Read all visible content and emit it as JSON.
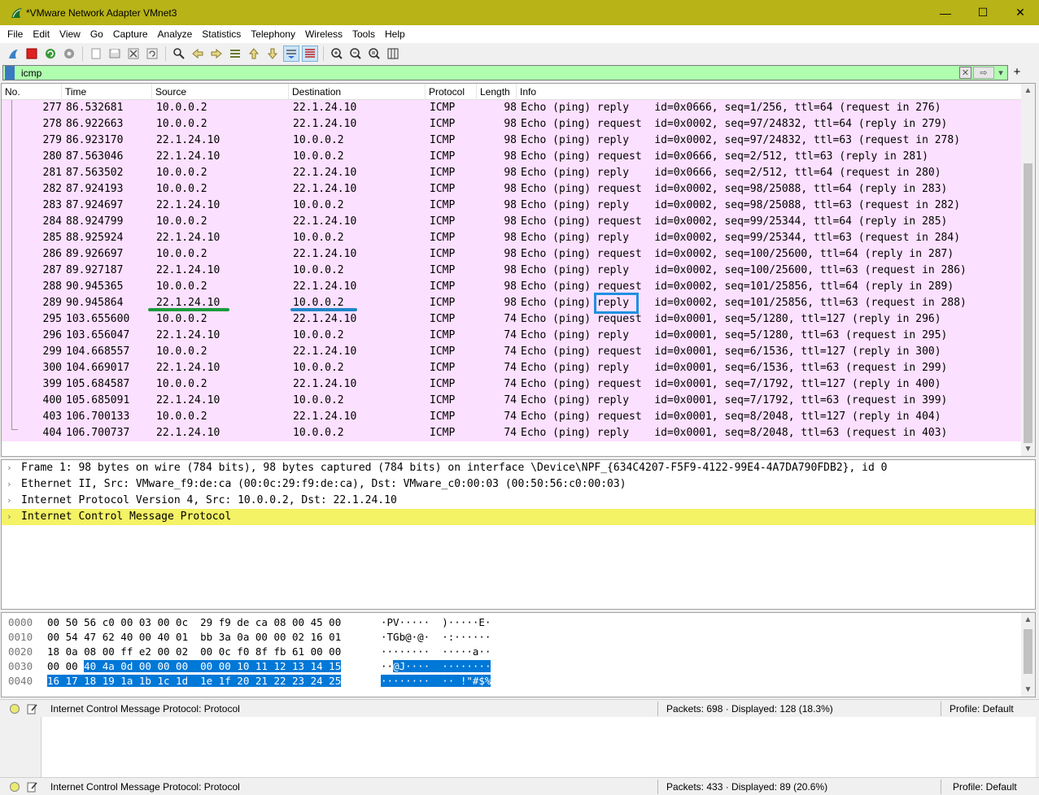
{
  "window": {
    "title": "*VMware Network Adapter VMnet3",
    "minimize": "—",
    "maximize": "☐",
    "close": "✕"
  },
  "menu": [
    "File",
    "Edit",
    "View",
    "Go",
    "Capture",
    "Analyze",
    "Statistics",
    "Telephony",
    "Wireless",
    "Tools",
    "Help"
  ],
  "filter": {
    "value": "icmp",
    "plus": "+"
  },
  "columns": [
    "No.",
    "Time",
    "Source",
    "Destination",
    "Protocol",
    "Length",
    "Info"
  ],
  "packets": [
    {
      "no": "277",
      "time": "86.532681",
      "src": "10.0.0.2",
      "dst": "22.1.24.10",
      "proto": "ICMP",
      "len": "98",
      "info": "Echo (ping) reply    id=0x0666, seq=1/256, ttl=64 (request in 276)"
    },
    {
      "no": "278",
      "time": "86.922663",
      "src": "10.0.0.2",
      "dst": "22.1.24.10",
      "proto": "ICMP",
      "len": "98",
      "info": "Echo (ping) request  id=0x0002, seq=97/24832, ttl=64 (reply in 279)"
    },
    {
      "no": "279",
      "time": "86.923170",
      "src": "22.1.24.10",
      "dst": "10.0.0.2",
      "proto": "ICMP",
      "len": "98",
      "info": "Echo (ping) reply    id=0x0002, seq=97/24832, ttl=63 (request in 278)"
    },
    {
      "no": "280",
      "time": "87.563046",
      "src": "22.1.24.10",
      "dst": "10.0.0.2",
      "proto": "ICMP",
      "len": "98",
      "info": "Echo (ping) request  id=0x0666, seq=2/512, ttl=63 (reply in 281)"
    },
    {
      "no": "281",
      "time": "87.563502",
      "src": "10.0.0.2",
      "dst": "22.1.24.10",
      "proto": "ICMP",
      "len": "98",
      "info": "Echo (ping) reply    id=0x0666, seq=2/512, ttl=64 (request in 280)"
    },
    {
      "no": "282",
      "time": "87.924193",
      "src": "10.0.0.2",
      "dst": "22.1.24.10",
      "proto": "ICMP",
      "len": "98",
      "info": "Echo (ping) request  id=0x0002, seq=98/25088, ttl=64 (reply in 283)"
    },
    {
      "no": "283",
      "time": "87.924697",
      "src": "22.1.24.10",
      "dst": "10.0.0.2",
      "proto": "ICMP",
      "len": "98",
      "info": "Echo (ping) reply    id=0x0002, seq=98/25088, ttl=63 (request in 282)"
    },
    {
      "no": "284",
      "time": "88.924799",
      "src": "10.0.0.2",
      "dst": "22.1.24.10",
      "proto": "ICMP",
      "len": "98",
      "info": "Echo (ping) request  id=0x0002, seq=99/25344, ttl=64 (reply in 285)"
    },
    {
      "no": "285",
      "time": "88.925924",
      "src": "22.1.24.10",
      "dst": "10.0.0.2",
      "proto": "ICMP",
      "len": "98",
      "info": "Echo (ping) reply    id=0x0002, seq=99/25344, ttl=63 (request in 284)"
    },
    {
      "no": "286",
      "time": "89.926697",
      "src": "10.0.0.2",
      "dst": "22.1.24.10",
      "proto": "ICMP",
      "len": "98",
      "info": "Echo (ping) request  id=0x0002, seq=100/25600, ttl=64 (reply in 287)"
    },
    {
      "no": "287",
      "time": "89.927187",
      "src": "22.1.24.10",
      "dst": "10.0.0.2",
      "proto": "ICMP",
      "len": "98",
      "info": "Echo (ping) reply    id=0x0002, seq=100/25600, ttl=63 (request in 286)"
    },
    {
      "no": "288",
      "time": "90.945365",
      "src": "10.0.0.2",
      "dst": "22.1.24.10",
      "proto": "ICMP",
      "len": "98",
      "info": "Echo (ping) request  id=0x0002, seq=101/25856, ttl=64 (reply in 289)"
    },
    {
      "no": "289",
      "time": "90.945864",
      "src": "22.1.24.10",
      "dst": "10.0.0.2",
      "proto": "ICMP",
      "len": "98",
      "info": "Echo (ping) reply    id=0x0002, seq=101/25856, ttl=63 (request in 288)"
    },
    {
      "no": "295",
      "time": "103.655600",
      "src": "10.0.0.2",
      "dst": "22.1.24.10",
      "proto": "ICMP",
      "len": "74",
      "info": "Echo (ping) request  id=0x0001, seq=5/1280, ttl=127 (reply in 296)"
    },
    {
      "no": "296",
      "time": "103.656047",
      "src": "22.1.24.10",
      "dst": "10.0.0.2",
      "proto": "ICMP",
      "len": "74",
      "info": "Echo (ping) reply    id=0x0001, seq=5/1280, ttl=63 (request in 295)"
    },
    {
      "no": "299",
      "time": "104.668557",
      "src": "10.0.0.2",
      "dst": "22.1.24.10",
      "proto": "ICMP",
      "len": "74",
      "info": "Echo (ping) request  id=0x0001, seq=6/1536, ttl=127 (reply in 300)"
    },
    {
      "no": "300",
      "time": "104.669017",
      "src": "22.1.24.10",
      "dst": "10.0.0.2",
      "proto": "ICMP",
      "len": "74",
      "info": "Echo (ping) reply    id=0x0001, seq=6/1536, ttl=63 (request in 299)"
    },
    {
      "no": "399",
      "time": "105.684587",
      "src": "10.0.0.2",
      "dst": "22.1.24.10",
      "proto": "ICMP",
      "len": "74",
      "info": "Echo (ping) request  id=0x0001, seq=7/1792, ttl=127 (reply in 400)"
    },
    {
      "no": "400",
      "time": "105.685091",
      "src": "22.1.24.10",
      "dst": "10.0.0.2",
      "proto": "ICMP",
      "len": "74",
      "info": "Echo (ping) reply    id=0x0001, seq=7/1792, ttl=63 (request in 399)"
    },
    {
      "no": "403",
      "time": "106.700133",
      "src": "10.0.0.2",
      "dst": "22.1.24.10",
      "proto": "ICMP",
      "len": "74",
      "info": "Echo (ping) request  id=0x0001, seq=8/2048, ttl=127 (reply in 404)"
    },
    {
      "no": "404",
      "time": "106.700737",
      "src": "22.1.24.10",
      "dst": "10.0.0.2",
      "proto": "ICMP",
      "len": "74",
      "info": "Echo (ping) reply    id=0x0001, seq=8/2048, ttl=63 (request in 403)"
    }
  ],
  "details": [
    {
      "text": "Frame 1: 98 bytes on wire (784 bits), 98 bytes captured (784 bits) on interface \\Device\\NPF_{634C4207-F5F9-4122-99E4-4A7DA790FDB2}, id 0",
      "highlight": false
    },
    {
      "text": "Ethernet II, Src: VMware_f9:de:ca (00:0c:29:f9:de:ca), Dst: VMware_c0:00:03 (00:50:56:c0:00:03)",
      "highlight": false
    },
    {
      "text": "Internet Protocol Version 4, Src: 10.0.0.2, Dst: 22.1.24.10",
      "highlight": false
    },
    {
      "text": "Internet Control Message Protocol",
      "highlight": true
    }
  ],
  "bytes": [
    {
      "offset": "0000",
      "hex": "00 50 56 c0 00 03 00 0c  29 f9 de ca 08 00 45 00",
      "ascii": "·PV·····  )·····E·",
      "sel_from": -1
    },
    {
      "offset": "0010",
      "hex": "00 54 47 62 40 00 40 01  bb 3a 0a 00 00 02 16 01",
      "ascii": "·TGb@·@·  ·:······",
      "sel_from": -1
    },
    {
      "offset": "0020",
      "hex": "18 0a 08 00 ff e2 00 02  00 0c f0 8f fb 61 00 00",
      "ascii": "········  ·····a··",
      "sel_from": -1
    },
    {
      "offset": "0030",
      "hex_pre": "00 00 ",
      "hex_sel": "40 4a 0d 00 00 00  00 00 10 11 12 13 14 15",
      "ascii_pre": "··",
      "ascii_sel": "@J····  ········"
    },
    {
      "offset": "0040",
      "hex_pre": "",
      "hex_sel": "16 17 18 19 1a 1b 1c 1d  1e 1f 20 21 22 23 24 25",
      "ascii_pre": "",
      "ascii_sel": "········  ·· !\"#$%"
    }
  ],
  "status1": {
    "proto": "Internet Control Message Protocol: Protocol",
    "packets": "Packets: 698 · Displayed: 128 (18.3%)",
    "profile": "Profile: Default"
  },
  "status2": {
    "proto": "Internet Control Message Protocol: Protocol",
    "packets": "Packets: 433 · Displayed: 89 (20.6%)",
    "profile": "Profile: Default"
  },
  "colors": {
    "titlebar": "#b8b316",
    "row_bg": "#fce0ff",
    "filter_bg": "#afffaf",
    "detail_highlight": "#f4f265",
    "byte_select": "#0078d7",
    "mark_green": "#1a9b3c",
    "mark_blue": "#1f86c7"
  }
}
